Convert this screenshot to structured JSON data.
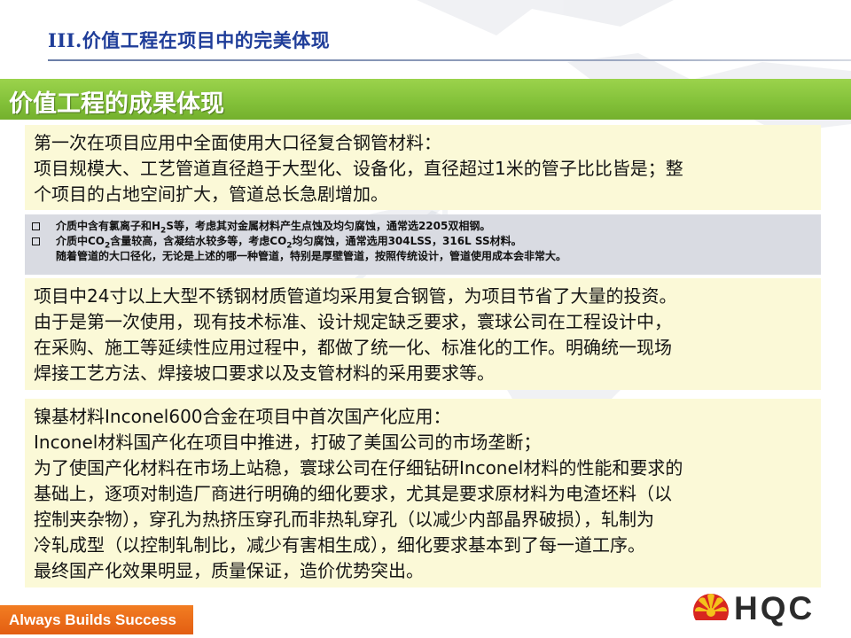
{
  "header": {
    "section_title": "III.价值工程在项目中的完美体现"
  },
  "banner": {
    "title": "价值工程的成果体现",
    "color": "#84c23a"
  },
  "box1": {
    "lines": [
      "第一次在项目应用中全面使用大口径复合钢管材料：",
      "项目规模大、工艺管道直径趋于大型化、设备化，直径超过1米的管子比比皆是；整",
      "个项目的占地空间扩大，管道总长急剧增加。"
    ]
  },
  "notes": {
    "bullet1": {
      "pre": "介质中含有氯离子和H",
      "sub": "2",
      "post": "S等，考虑其对金属材料产生点蚀及均匀腐蚀，通常选2205双相钢。"
    },
    "bullet2": {
      "pre": "介质中CO",
      "sub1": "2",
      "mid": "含量较高，含凝结水较多等，考虑CO",
      "sub2": "2",
      "post": "均匀腐蚀，通常选用304LSS，316L SS材料。"
    },
    "line3": "随着管道的大口径化，无论是上述的哪一种管道，特别是厚壁管道，按照传统设计，管道使用成本会非常大。"
  },
  "box3": {
    "lines": [
      "项目中24寸以上大型不锈钢材质管道均采用复合钢管，为项目节省了大量的投资。",
      "由于是第一次使用，现有技术标准、设计规定缺乏要求，寰球公司在工程设计中，",
      "在采购、施工等延续性应用过程中，都做了统一化、标准化的工作。明确统一现场",
      "焊接工艺方法、焊接坡口要求以及支管材料的采用要求等。"
    ]
  },
  "box4": {
    "lines": [
      "镍基材料Inconel600合金在项目中首次国产化应用：",
      "Inconel材料国产化在项目中推进，打破了美国公司的市场垄断；",
      "为了使国产化材料在市场上站稳，寰球公司在仔细钻研Inconel材料的性能和要求的",
      "基础上，逐项对制造厂商进行明确的细化要求，尤其是要求原材料为电渣坯料（以",
      "控制夹杂物），穿孔为热挤压穿孔而非热轧穿孔（以减少内部晶界破损），轧制为",
      "冷轧成型（以控制轧制比，减少有害相生成），细化要求基本到了每一道工序。",
      "最终国产化效果明显，质量保证，造价优势突出。"
    ]
  },
  "footer": {
    "slogan": "Always Builds Success",
    "logo_text": "HQC",
    "slogan_color": "#e86a18",
    "logo_red": "#d8261f",
    "logo_yellow": "#f4c21b"
  }
}
